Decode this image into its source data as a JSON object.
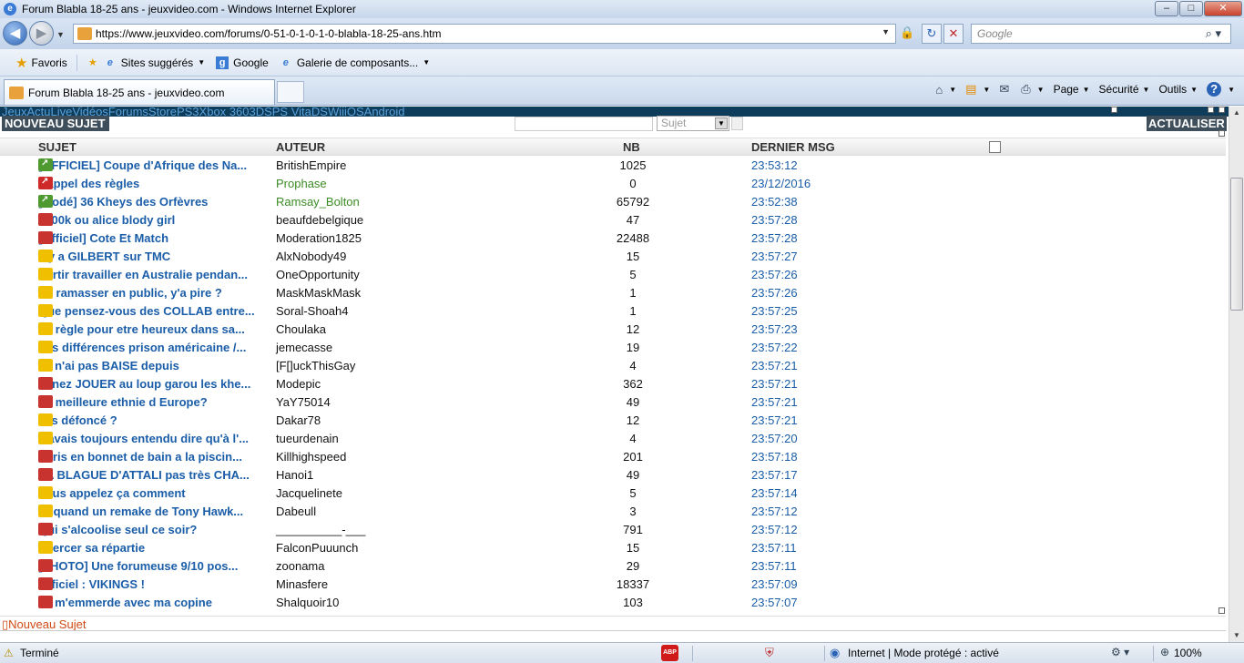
{
  "window": {
    "title": "Forum Blabla 18-25 ans - jeuxvideo.com - Windows Internet Explorer",
    "min": "–",
    "max": "□",
    "close": "✕"
  },
  "address": {
    "url": "https://www.jeuxvideo.com/forums/0-51-0-1-0-1-0-blabla-18-25-ans.htm",
    "search_placeholder": "Google"
  },
  "favorites": {
    "favoris_label": "Favoris",
    "items": [
      {
        "label": "Sites suggérés",
        "icon": "ie-icon",
        "has_arrow": true
      },
      {
        "label": "Google",
        "icon": "google-icon",
        "has_arrow": false
      },
      {
        "label": "Galerie de composants...",
        "icon": "ie-icon",
        "has_arrow": true
      }
    ]
  },
  "tabs": {
    "active_label": "Forum Blabla 18-25 ans - jeuxvideo.com"
  },
  "commandbar": {
    "page": "Page",
    "securite": "Sécurité",
    "outils": "Outils"
  },
  "site": {
    "top_links": "JeuxActuLiveVidéosForumsStorePS3Xbox 3603DSPS VitaDSWiiiOSAndroid",
    "new_topic_button": "NOUVEAU SUJET",
    "refresh_button": "ACTUALISER",
    "search_select": "Sujet",
    "bottom_new_topic": "Nouveau Sujet"
  },
  "table": {
    "headers": {
      "sujet": "SUJET",
      "auteur": "AUTEUR",
      "nb": "NB",
      "dernier": "DERNIER MSG"
    },
    "rows": [
      {
        "icon": "pin",
        "subject": "[OFFICIEL] Coupe d'Afrique des Na...",
        "author": "BritishEmpire",
        "author_mod": false,
        "nb": "1025",
        "last": "23:53:12"
      },
      {
        "icon": "pinred",
        "subject": "Rappel des règles",
        "author": "Prophase",
        "author_mod": true,
        "nb": "0",
        "last": "23/12/2016"
      },
      {
        "icon": "pin",
        "subject": "[Modé] 36 Kheys des Orfèvres",
        "author": "Ramsay_Bolton",
        "author_mod": true,
        "nb": "65792",
        "last": "23:52:38"
      },
      {
        "icon": "red",
        "subject": "1000k ou alice blody girl",
        "author": "beaufdebelgique",
        "author_mod": false,
        "nb": "47",
        "last": "23:57:28"
      },
      {
        "icon": "red",
        "subject": "[Officiel] Cote Et Match",
        "author": "Moderation1825",
        "author_mod": false,
        "nb": "22488",
        "last": "23:57:28"
      },
      {
        "icon": "yellow",
        "subject": "Il y a GILBERT sur TMC",
        "author": "AlxNobody49",
        "author_mod": false,
        "nb": "15",
        "last": "23:57:27"
      },
      {
        "icon": "yellow",
        "subject": "Partir travailler en Australie pendan...",
        "author": "OneOpportunity",
        "author_mod": false,
        "nb": "5",
        "last": "23:57:26"
      },
      {
        "icon": "yellow",
        "subject": "Se ramasser en public, y'a pire ?",
        "author": "MaskMaskMask",
        "author_mod": false,
        "nb": "1",
        "last": "23:57:26"
      },
      {
        "icon": "yellow",
        "subject": "Que pensez-vous des COLLAB entre...",
        "author": "Soral-Shoah4",
        "author_mod": false,
        "nb": "1",
        "last": "23:57:25"
      },
      {
        "icon": "yellow",
        "subject": "La règle pour etre heureux dans sa...",
        "author": "Choulaka",
        "author_mod": false,
        "nb": "12",
        "last": "23:57:23"
      },
      {
        "icon": "yellow",
        "subject": "Les différences prison américaine /...",
        "author": "jemecasse",
        "author_mod": false,
        "nb": "19",
        "last": "23:57:22"
      },
      {
        "icon": "yellow",
        "subject": "Je n'ai pas BAISE depuis",
        "author": "[F[]uckThisGay",
        "author_mod": false,
        "nb": "4",
        "last": "23:57:21"
      },
      {
        "icon": "red",
        "subject": "Venez JOUER au loup garou les khe...",
        "author": "Modepic",
        "author_mod": false,
        "nb": "362",
        "last": "23:57:21"
      },
      {
        "icon": "red",
        "subject": "La meilleure ethnie d Europe?",
        "author": "YaY75014",
        "author_mod": false,
        "nb": "49",
        "last": "23:57:21"
      },
      {
        "icon": "yellow",
        "subject": "Jes défoncé ?",
        "author": "Dakar78",
        "author_mod": false,
        "nb": "12",
        "last": "23:57:21"
      },
      {
        "icon": "yellow",
        "subject": "J'avais toujours entendu dire qu'à l'...",
        "author": "tueurdenain",
        "author_mod": false,
        "nb": "4",
        "last": "23:57:20"
      },
      {
        "icon": "red",
        "subject": "Paris en bonnet de bain a la piscin...",
        "author": "Killhighspeed",
        "author_mod": false,
        "nb": "201",
        "last": "23:57:18"
      },
      {
        "icon": "red",
        "subject": "LA BLAGUE D'ATTALI pas très CHA...",
        "author": "Hanoi1",
        "author_mod": false,
        "nb": "49",
        "last": "23:57:17"
      },
      {
        "icon": "yellow",
        "subject": "Vous appelez ça comment",
        "author": "Jacquelinete",
        "author_mod": false,
        "nb": "5",
        "last": "23:57:14"
      },
      {
        "icon": "yellow",
        "subject": "Et quand un remake de Tony Hawk...",
        "author": "Dabeull",
        "author_mod": false,
        "nb": "3",
        "last": "23:57:12"
      },
      {
        "icon": "red",
        "subject": "Qui s'alcoolise seul ce soir?",
        "author": "__________-___",
        "author_mod": false,
        "nb": "791",
        "last": "23:57:12"
      },
      {
        "icon": "yellow",
        "subject": "Exercer sa répartie",
        "author": "FalconPuuunch",
        "author_mod": false,
        "nb": "15",
        "last": "23:57:11"
      },
      {
        "icon": "red",
        "subject": "[PHOTO] Une forumeuse 9/10 pos...",
        "author": "zoonama",
        "author_mod": false,
        "nb": "29",
        "last": "23:57:11"
      },
      {
        "icon": "red",
        "subject": "Officiel : VIKINGS !",
        "author": "Minasfere",
        "author_mod": false,
        "nb": "18337",
        "last": "23:57:09"
      },
      {
        "icon": "red",
        "subject": "Je m'emmerde avec ma copine",
        "author": "Shalquoir10",
        "author_mod": false,
        "nb": "103",
        "last": "23:57:07"
      }
    ]
  },
  "status": {
    "left": "Terminé",
    "abp": "ABP",
    "zone": "Internet | Mode protégé : activé",
    "zoom": "100%"
  },
  "colors": {
    "link": "#1a5da8",
    "moderator": "#3c8c25",
    "header_stripe": "#0e3c5b",
    "button_bg": "#3e4e5a",
    "bottom_link": "#d04a14"
  }
}
